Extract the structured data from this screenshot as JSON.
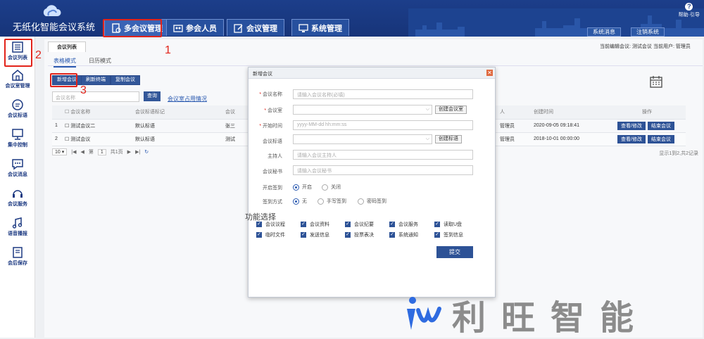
{
  "header": {
    "app_title": "无纸化智能会议系统",
    "nav": [
      "多会议管理",
      "参会人员",
      "会议管理",
      "系统管理"
    ],
    "right_buttons": [
      "系统消息",
      "注销系统"
    ],
    "help_label": "帮助·引导"
  },
  "sidebar": {
    "items": [
      "会议列表",
      "会议室管理",
      "会议标语",
      "集中控制",
      "会议消息",
      "会议服务",
      "语音播报",
      "会后保存"
    ]
  },
  "main": {
    "tab": "会议列表",
    "current_meeting": "当前编辑会议: 测试会议",
    "current_user": "当前用户: 管理员",
    "subtabs": [
      "表格模式",
      "日历模式"
    ],
    "actions": [
      "新增会议",
      "刷新终端",
      "复制会议"
    ],
    "search_placeholder": "会议名称",
    "search_button": "查询",
    "room_link": "会议室占用情况",
    "table": {
      "columns": [
        "会议名称",
        "会议标语标记",
        "会议",
        "人",
        "创建时间",
        "操作"
      ],
      "rows": [
        {
          "no": "1",
          "name": "测试会议二",
          "tag": "默认标语",
          "room": "张三",
          "creator": "管理员",
          "created": "2020-09-05 09:18:41"
        },
        {
          "no": "2",
          "name": "测试会议",
          "tag": "默认标语",
          "room": "测试",
          "creator": "管理员",
          "created": "2018-10-01 00:00:00"
        }
      ],
      "row_actions": [
        "查看/修改",
        "结束会议"
      ]
    },
    "pager": {
      "page_size": "10",
      "page_label": "第",
      "page": "1",
      "total_pages": "共1页"
    },
    "summary": "显示1到2,共2记录"
  },
  "modal": {
    "title": "新增会议",
    "close": "✕",
    "fields": [
      {
        "label": "会议名称",
        "required": true,
        "placeholder": "请输入会议名称(必填)"
      },
      {
        "label": "会议室",
        "required": true,
        "placeholder": ""
      },
      {
        "label": "开始时间",
        "required": true,
        "placeholder": "yyyy-MM-dd hh:mm:ss"
      },
      {
        "label": "会议标语",
        "required": false,
        "placeholder": ""
      },
      {
        "label": "主持人",
        "required": false,
        "placeholder": "请输入会议主持人"
      },
      {
        "label": "会议秘书",
        "required": false,
        "placeholder": "请输入会议秘书"
      }
    ],
    "create_room_button": "创建会议室",
    "create_slogan_button": "创建标语",
    "signin_label": "开启签到",
    "signin_options": [
      "开启",
      "关闭"
    ],
    "method_label": "签到方式",
    "method_options": [
      "无",
      "手写签到",
      "密码签到"
    ],
    "functions_title": "功能选择",
    "functions": [
      "会议议程",
      "会议资料",
      "会议纪要",
      "会议服务",
      "读取U盘",
      "临时文件",
      "发送信息",
      "投票表决",
      "系统通知",
      "签到信息"
    ],
    "submit": "提交"
  },
  "annotations": [
    "1",
    "2",
    "3"
  ],
  "watermark": "利旺智能",
  "colors": {
    "header": "#1c3e8a",
    "accent": "#2d5296",
    "annotation": "#e2231a"
  }
}
